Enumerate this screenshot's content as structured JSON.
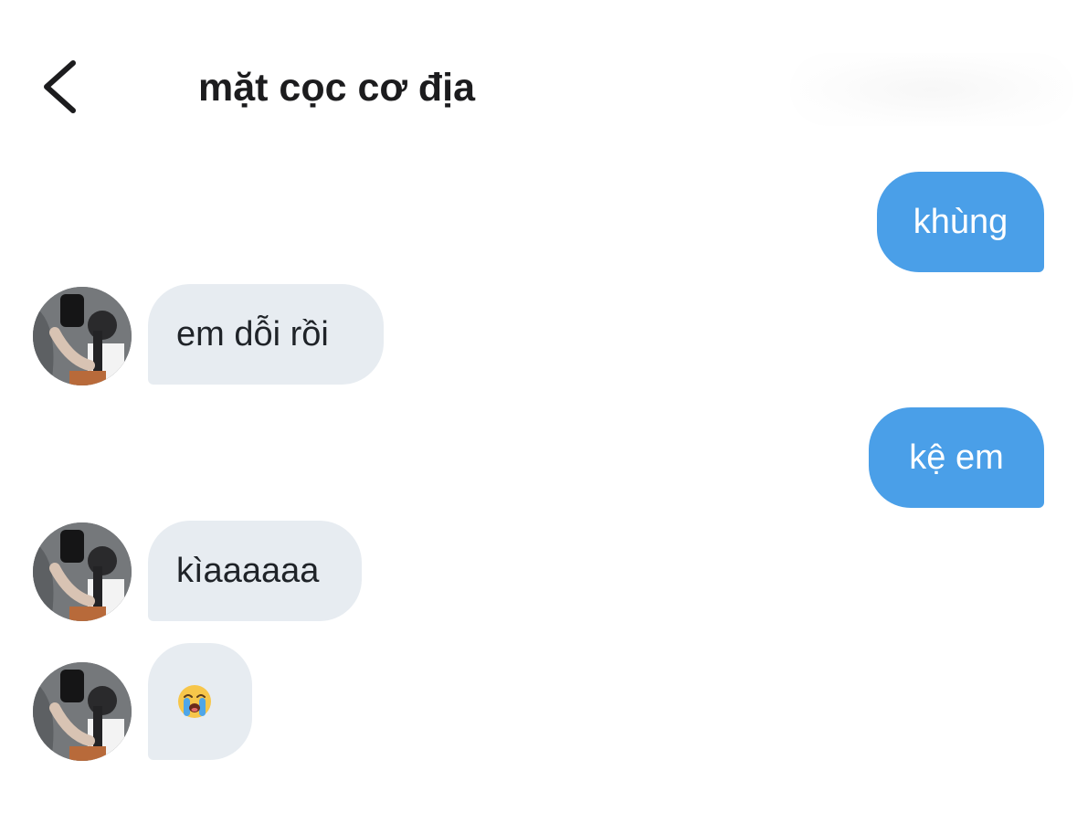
{
  "header": {
    "back_icon": "chevron-left-icon",
    "title": "mặt cọc cơ địa"
  },
  "colors": {
    "outgoing_bubble": "#4a9fe8",
    "incoming_bubble": "#e7ecf1",
    "outgoing_text": "#ffffff",
    "incoming_text": "#1f2328"
  },
  "messages": [
    {
      "direction": "outgoing",
      "text": "khùng"
    },
    {
      "direction": "incoming",
      "text": "em dỗi rồi",
      "avatar": "contact-avatar"
    },
    {
      "direction": "outgoing",
      "text": "kệ em"
    },
    {
      "direction": "incoming",
      "text": "kìaaaaaa",
      "avatar": "contact-avatar"
    },
    {
      "direction": "incoming",
      "emoji": "loudly-crying-face-emoji",
      "avatar": "contact-avatar"
    }
  ]
}
